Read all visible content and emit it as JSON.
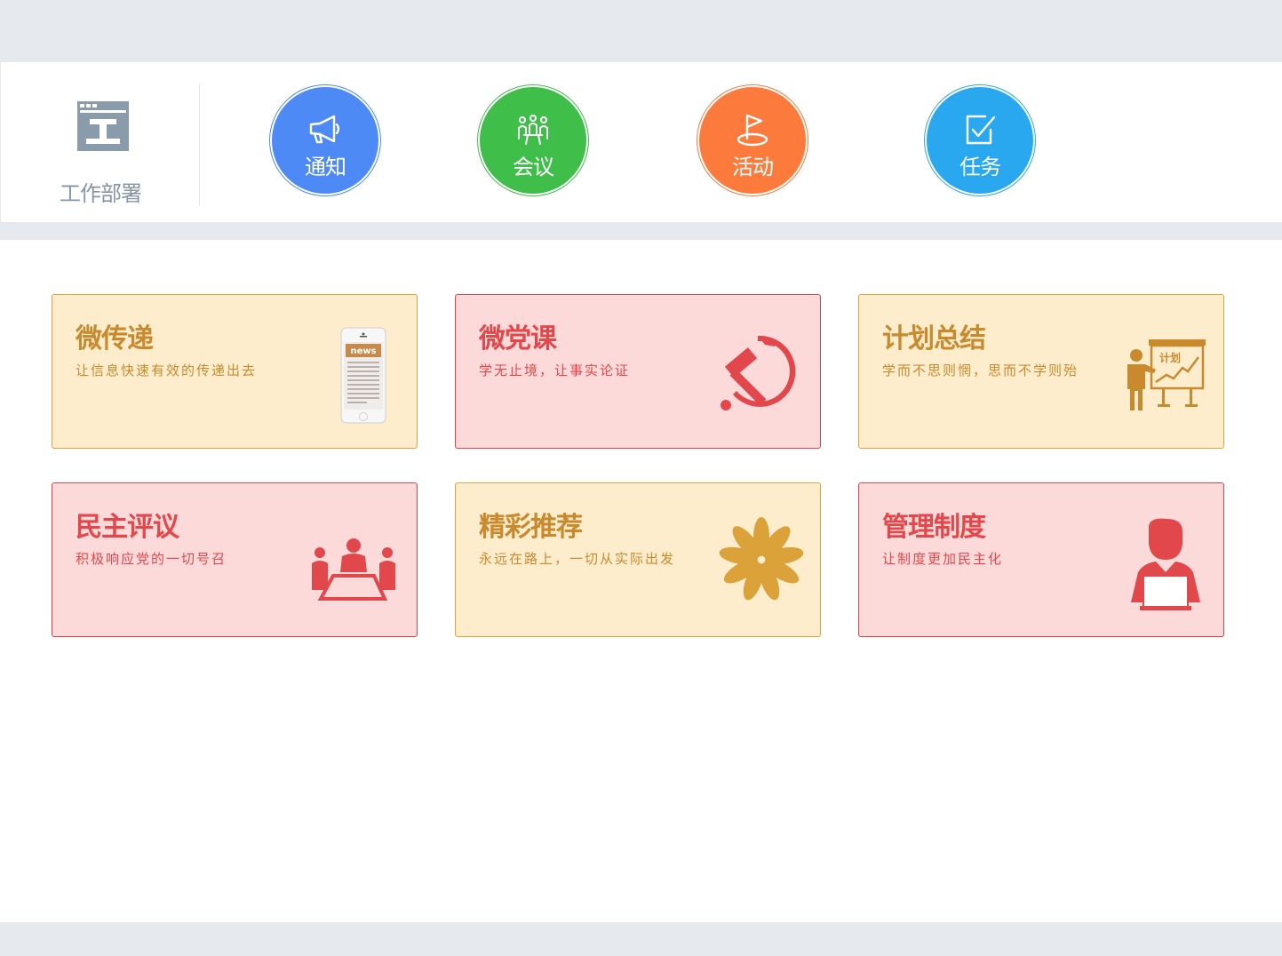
{
  "work_deploy": {
    "label": "工作部署",
    "icon": "window-icon"
  },
  "quick_actions": [
    {
      "label": "通知",
      "icon": "megaphone-icon",
      "color": "#4d8af5"
    },
    {
      "label": "会议",
      "icon": "meeting-icon",
      "color": "#3fbf4a"
    },
    {
      "label": "活动",
      "icon": "flag-icon",
      "color": "#fb7a3c"
    },
    {
      "label": "任务",
      "icon": "task-check-icon",
      "color": "#29a8f0"
    }
  ],
  "cards": [
    {
      "title": "微传递",
      "subtitle": "让信息快速有效的传递出去",
      "icon": "news-phone-icon",
      "screen_text": "news",
      "theme": "yellow"
    },
    {
      "title": "微党课",
      "subtitle": "学无止境，让事实论证",
      "icon": "hammer-sickle-icon",
      "theme": "pink"
    },
    {
      "title": "计划总结",
      "subtitle": "学而不思则惘，思而不学则殆",
      "icon": "presenter-board-icon",
      "board_text": "计划",
      "theme": "yellow"
    },
    {
      "title": "民主评议",
      "subtitle": "积极响应党的一切号召",
      "icon": "discussion-group-icon",
      "theme": "pink"
    },
    {
      "title": "精彩推荐",
      "subtitle": "永远在路上，一切从实际出发",
      "icon": "flower-icon",
      "theme": "yellow"
    },
    {
      "title": "管理制度",
      "subtitle": "让制度更加民主化",
      "icon": "person-laptop-icon",
      "theme": "pink"
    }
  ],
  "colors": {
    "yellow_bg": "#fdedcc",
    "yellow_text": "#c98a2e",
    "pink_bg": "#fddada",
    "pink_text": "#e2474b"
  }
}
